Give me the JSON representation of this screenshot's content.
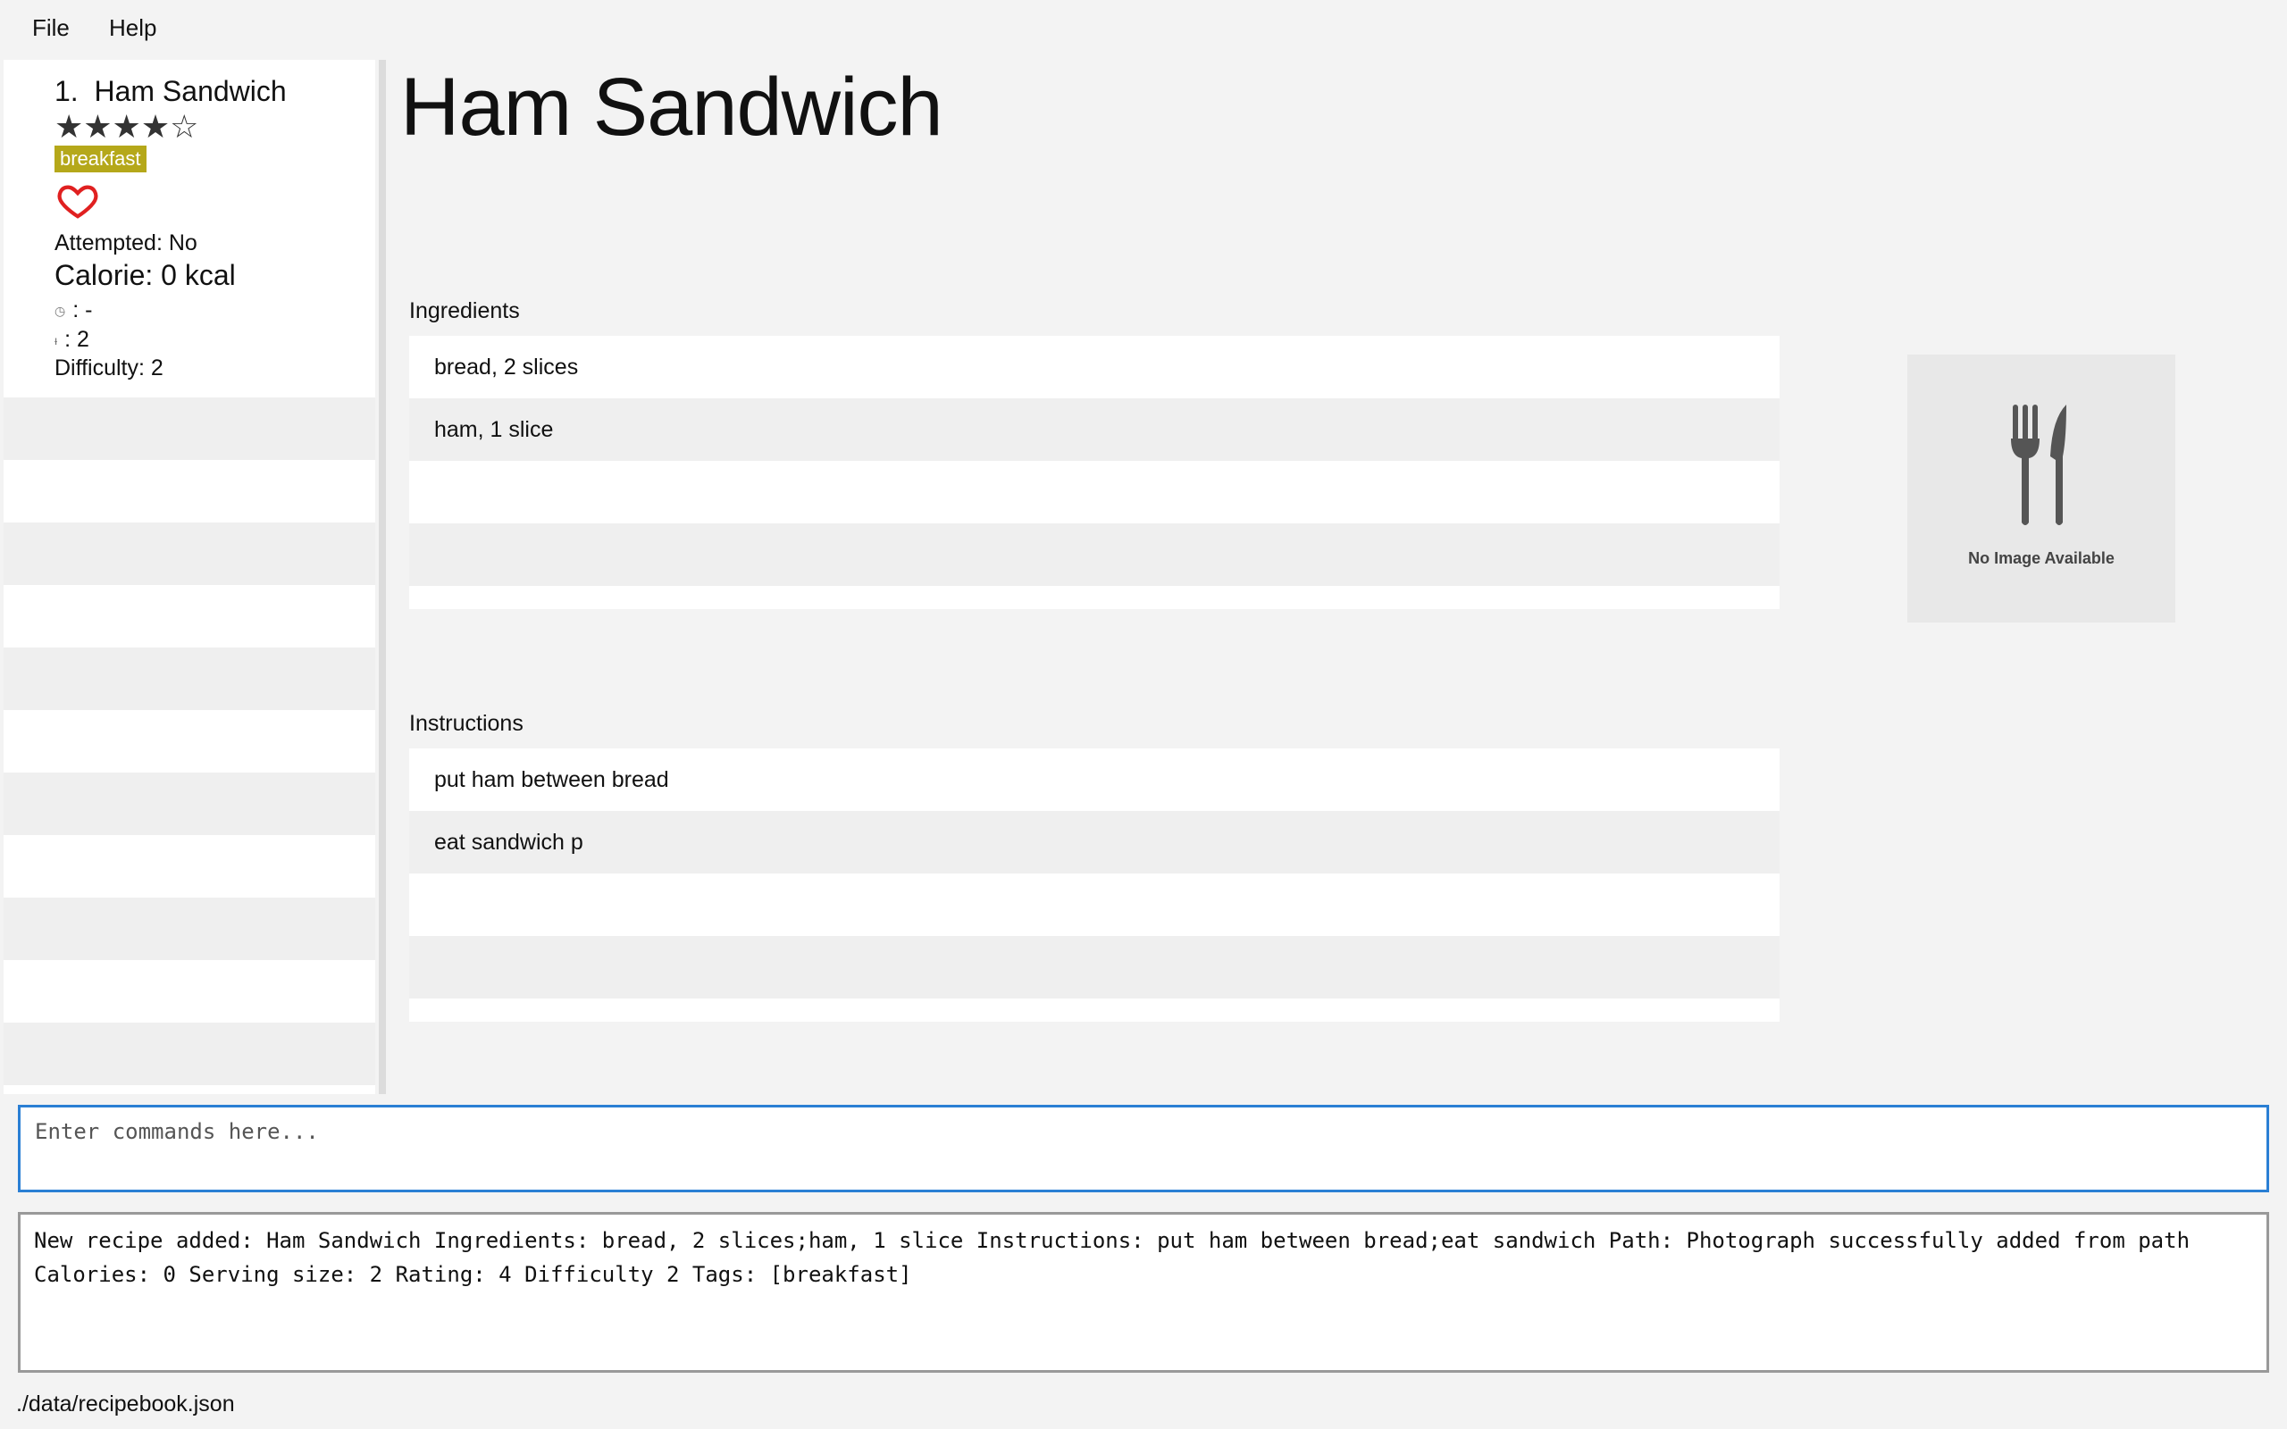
{
  "menu": {
    "file": "File",
    "help": "Help"
  },
  "recipe_list": {
    "items": [
      {
        "index": "1.",
        "name": "Ham Sandwich",
        "rating": 4,
        "rating_max": 5,
        "tag": "breakfast",
        "attempted": "Attempted: No",
        "calorie": "Calorie: 0 kcal",
        "prep_time": ": -",
        "servings": ": 2",
        "difficulty": "Difficulty: 2",
        "favourite_icon": "heart-outline-icon",
        "time_icon": "clock-icon",
        "serving_icon": "fork-knife-icon"
      }
    ]
  },
  "detail": {
    "title": "Ham Sandwich",
    "ingredients_label": "Ingredients",
    "ingredients": [
      "bread, 2 slices",
      "ham, 1 slice"
    ],
    "instructions_label": "Instructions",
    "instructions": [
      "put ham between bread",
      "eat sandwich p"
    ],
    "image_placeholder": "No Image Available",
    "image_icon": "fork-knife-icon"
  },
  "command": {
    "placeholder": "Enter commands here...",
    "value": ""
  },
  "result": {
    "text": "New recipe added: Ham Sandwich Ingredients: bread, 2 slices;ham, 1 slice Instructions: put ham between bread;eat sandwich Path: Photograph successfully added from path\nCalories: 0 Serving size: 2 Rating: 4 Difficulty 2 Tags: [breakfast]"
  },
  "status_bar": {
    "path": "./data/recipebook.json"
  },
  "colors": {
    "accent": "#2a7fd4",
    "tag": "#b5a81a",
    "heart": "#e02020"
  }
}
